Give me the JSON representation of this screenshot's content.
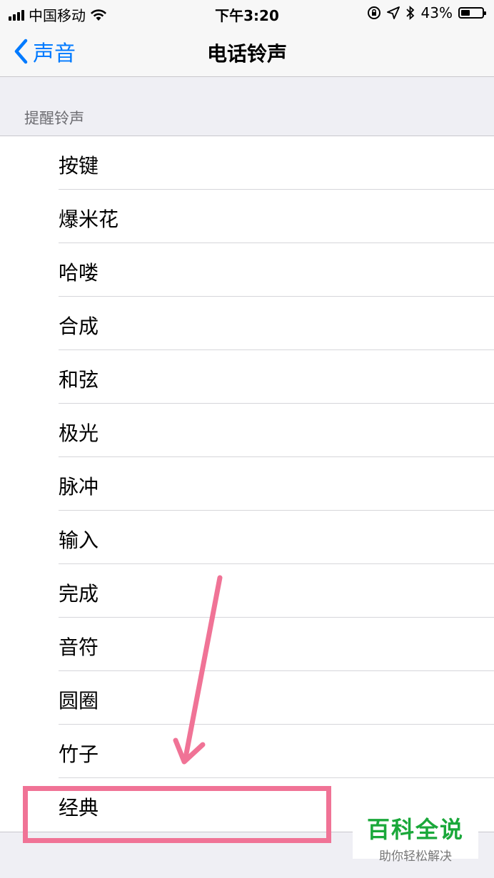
{
  "status_bar": {
    "carrier": "中国移动",
    "time": "下午3:20",
    "battery": "43%",
    "battery_level": 0.43,
    "icons": [
      "signal-icon",
      "wifi-icon",
      "orientation-lock-icon",
      "location-icon",
      "bluetooth-icon",
      "battery-icon"
    ]
  },
  "nav": {
    "back_label": "声音",
    "title": "电话铃声"
  },
  "section": {
    "header": "提醒铃声",
    "items": [
      {
        "label": "按键"
      },
      {
        "label": "爆米花"
      },
      {
        "label": "哈喽"
      },
      {
        "label": "合成"
      },
      {
        "label": "和弦"
      },
      {
        "label": "极光"
      },
      {
        "label": "脉冲"
      },
      {
        "label": "输入"
      },
      {
        "label": "完成"
      },
      {
        "label": "音符"
      },
      {
        "label": "圆圈"
      },
      {
        "label": "竹子"
      },
      {
        "label": "经典"
      }
    ]
  },
  "annotation": {
    "color": "#f07396"
  },
  "watermark": {
    "title": "百科全说",
    "subtitle": "助你轻松解决"
  },
  "colors": {
    "accent": "#007aff",
    "watermark_green": "#1aa83a"
  }
}
